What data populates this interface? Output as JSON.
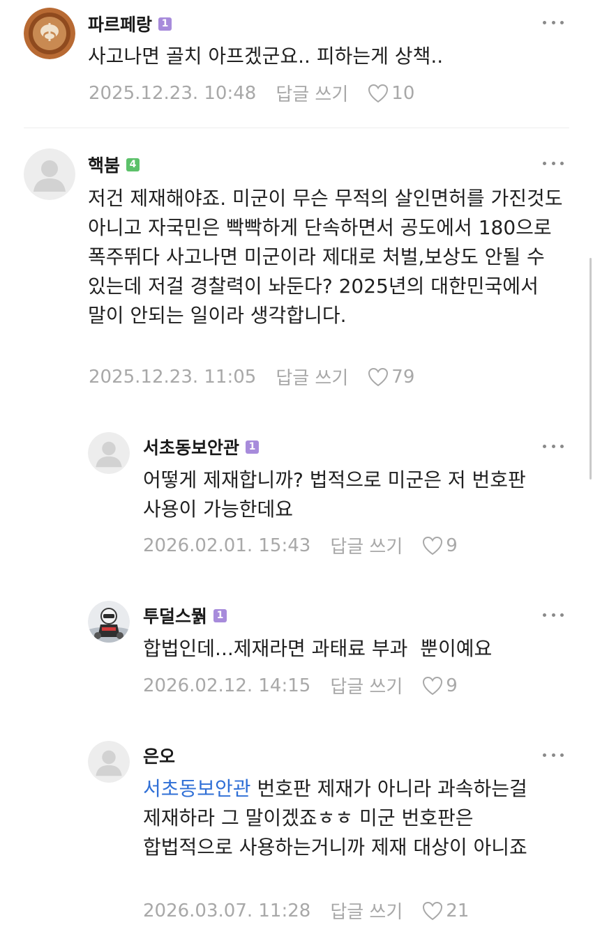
{
  "colors": {
    "level_purple": "#a78bdb",
    "level_green": "#5cc16a",
    "mention": "#2f6fd6",
    "meta": "#a8a8a8"
  },
  "comments": [
    {
      "author": "파르페랑",
      "level": "1",
      "text": "사고나면 골치 아프겠군요.. 피하는게 상책..",
      "date": "2025.12.23. 10:48",
      "reply_label": "답글 쓰기",
      "likes": "10",
      "avatar": "latte-art-avatar"
    },
    {
      "author": "핵붐",
      "level": "4",
      "text": "저건 제재해야죠. 미군이 무슨 무적의 살인면허를 가진것도 아니고 자국민은 빡빡하게 단속하면서 공도에서 180으로 폭주뛰다 사고나면 미군이라 제대로 처벌,보상도 안될 수 있는데 저걸 경찰력이 놔둔다? 2025년의 대한민국에서 말이 안되는 일이라 생각합니다.",
      "date": "2025.12.23. 11:05",
      "reply_label": "답글 쓰기",
      "likes": "79",
      "avatar": "default-avatar"
    },
    {
      "author": "서초동보안관",
      "level": "1",
      "text": "어떻게 제재합니까? 법적으로 미군은 저 번호판 사용이 가능한데요",
      "date": "2026.02.01. 15:43",
      "reply_label": "답글 쓰기",
      "likes": "9",
      "avatar": "default-avatar"
    },
    {
      "author": "투덜스뭙",
      "level": "1",
      "text": "합법인데...제재라면 과태료 부과  뿐이예요",
      "date": "2026.02.12. 14:15",
      "reply_label": "답글 쓰기",
      "likes": "9",
      "avatar": "helmet-rider-avatar"
    },
    {
      "author": "은오",
      "mention": "서초동보안관",
      "text": " 번호판 제재가 아니라 과속하는걸 제재하라 그 말이겠죠ㅎㅎ 미군 번호판은 합법적으로 사용하는거니까 제재 대상이 아니죠",
      "date": "2026.03.07. 11:28",
      "reply_label": "답글 쓰기",
      "likes": "21",
      "avatar": "default-avatar"
    }
  ]
}
